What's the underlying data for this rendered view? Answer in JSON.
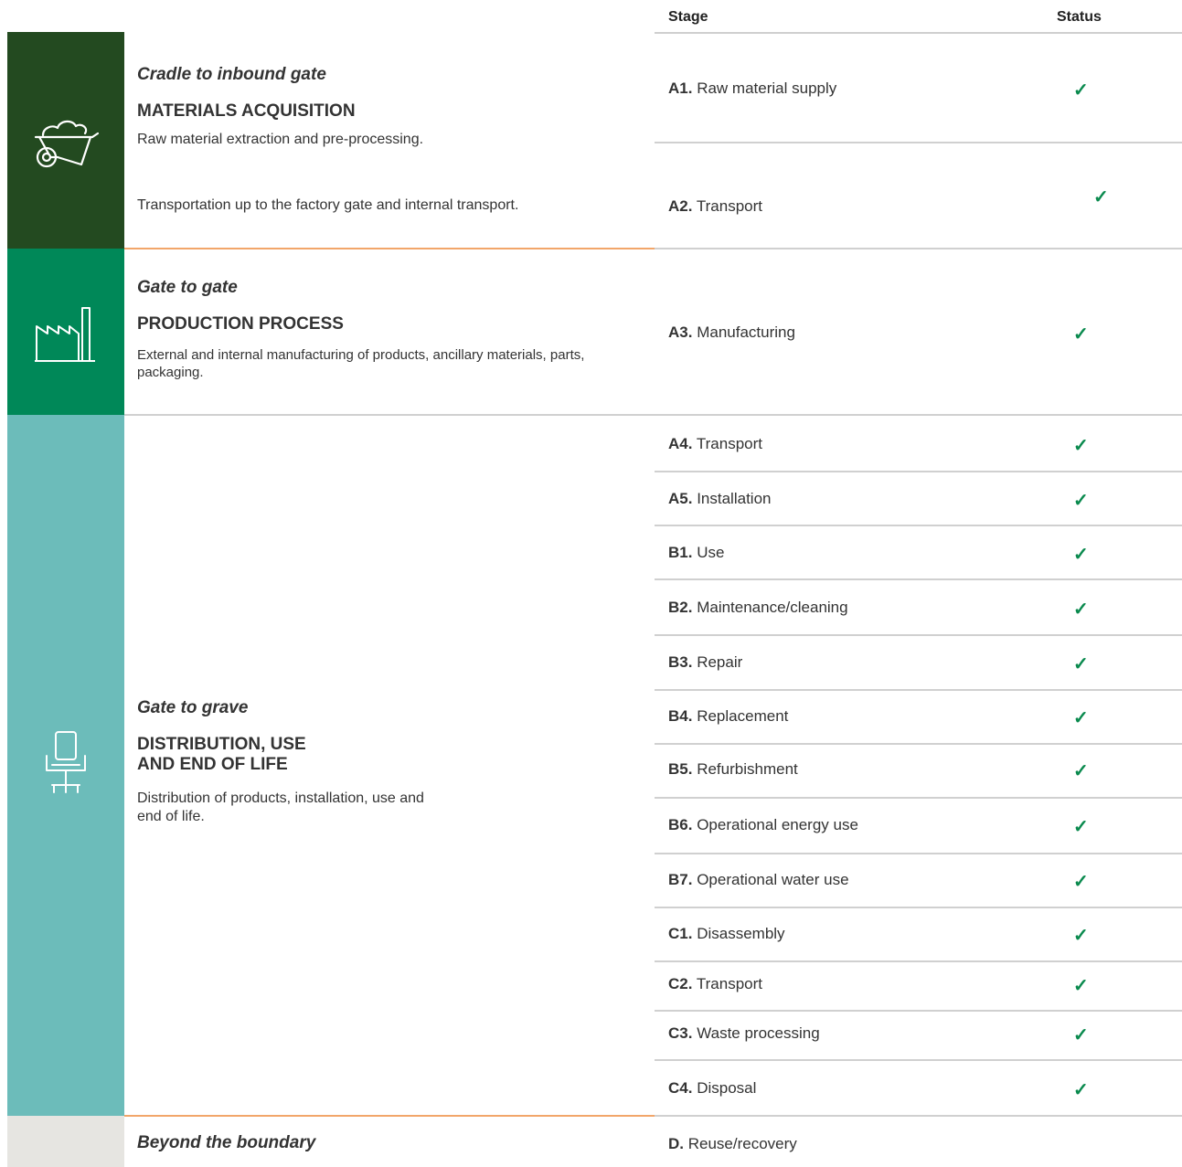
{
  "header": {
    "stage": "Stage",
    "status": "Status"
  },
  "colors": {
    "materials": "#234a20",
    "production": "#008858",
    "distribution": "#6cbcba",
    "beyond": "#e6e5e1",
    "check": "#0a8a4e",
    "orange_divider": "#f2a66a"
  },
  "phases": [
    {
      "icon": "wheelbarrow-icon",
      "subtitle": "Cradle to inbound gate",
      "title": "MATERIALS ACQUISITION",
      "description": "Raw material extraction and pre-processing.",
      "description2": "Transportation up to the factory gate and internal transport."
    },
    {
      "icon": "factory-icon",
      "subtitle": "Gate to gate",
      "title": "PRODUCTION PROCESS",
      "description": "External and internal manufacturing of products, ancillary materials, parts, packaging."
    },
    {
      "icon": "office-chair-icon",
      "subtitle": "Gate to grave",
      "title_line1": "DISTRIBUTION, USE",
      "title_line2": "AND END OF LIFE",
      "description_line1": "Distribution of products, installation, use and",
      "description_line2": "end of life."
    },
    {
      "subtitle": "Beyond the boundary"
    }
  ],
  "stages": [
    {
      "code": "A1.",
      "name": "Raw material supply",
      "status": "✓"
    },
    {
      "code": "A2.",
      "name": "Transport",
      "status": "✓"
    },
    {
      "code": "A3.",
      "name": "Manufacturing",
      "status": "✓"
    },
    {
      "code": "A4.",
      "name": "Transport",
      "status": "✓"
    },
    {
      "code": "A5.",
      "name": "Installation",
      "status": "✓"
    },
    {
      "code": "B1.",
      "name": "Use",
      "status": "✓"
    },
    {
      "code": "B2.",
      "name": "Maintenance/cleaning",
      "status": "✓"
    },
    {
      "code": "B3.",
      "name": "Repair",
      "status": "✓"
    },
    {
      "code": "B4.",
      "name": "Replacement",
      "status": "✓"
    },
    {
      "code": "B5.",
      "name": "Refurbishment",
      "status": "✓"
    },
    {
      "code": "B6.",
      "name": "Operational energy use",
      "status": "✓"
    },
    {
      "code": "B7.",
      "name": "Operational water use",
      "status": "✓"
    },
    {
      "code": "C1.",
      "name": "Disassembly",
      "status": "✓"
    },
    {
      "code": "C2.",
      "name": "Transport",
      "status": "✓"
    },
    {
      "code": "C3.",
      "name": "Waste processing",
      "status": "✓"
    },
    {
      "code": "C4.",
      "name": "Disposal",
      "status": "✓"
    },
    {
      "code": "D.",
      "name": "Reuse/recovery",
      "status": ""
    }
  ]
}
